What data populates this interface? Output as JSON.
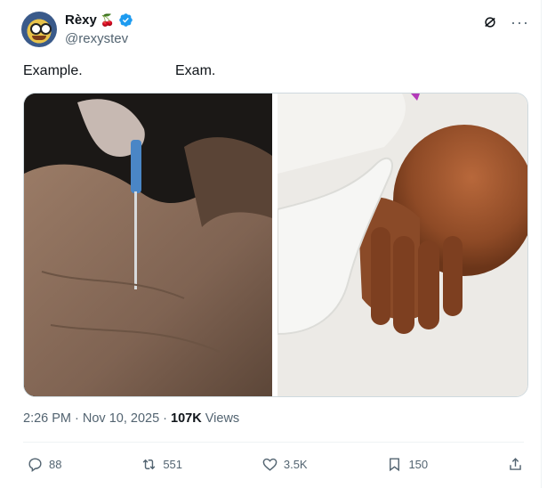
{
  "author": {
    "name": "Rèxy",
    "name_emoji": "🍒",
    "handle": "@rexystev"
  },
  "post": {
    "caption_left": "Example.",
    "caption_right": "Exam.",
    "time": "2:26 PM",
    "date": "Nov 10, 2025",
    "views_count": "107K",
    "views_label": "Views"
  },
  "stats": {
    "replies": "88",
    "reposts": "551",
    "likes": "3.5K",
    "bookmarks": "150"
  },
  "colors": {
    "verified": "#1d9bf0",
    "muted": "#536471"
  }
}
